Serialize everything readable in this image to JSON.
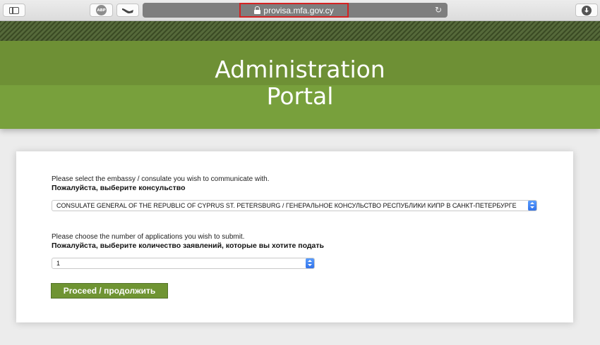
{
  "browser": {
    "url": "provisa.mfa.gov.cy",
    "abp_label": "ABP"
  },
  "header": {
    "title_line1": "Administration",
    "title_line2": "Portal"
  },
  "form": {
    "embassy_label_en": "Please select the embassy / consulate you wish to communicate with.",
    "embassy_label_ru": "Пожалуйста, выберите консульство",
    "embassy_selected": "CONSULATE GENERAL OF THE REPUBLIC OF CYPRUS ST. PETERSBURG / ГЕНЕРАЛЬНОЕ КОНСУЛЬСТВО РЕСПУБЛИКИ КИПР В САНКТ-ПЕТЕРБУРГЕ",
    "count_label_en": "Please choose the number of applications you wish to submit.",
    "count_label_ru": "Пожалуйста, выберите количество заявлений, которые вы хотите подать",
    "count_selected": "1",
    "proceed_label": "Proceed / продолжить"
  }
}
